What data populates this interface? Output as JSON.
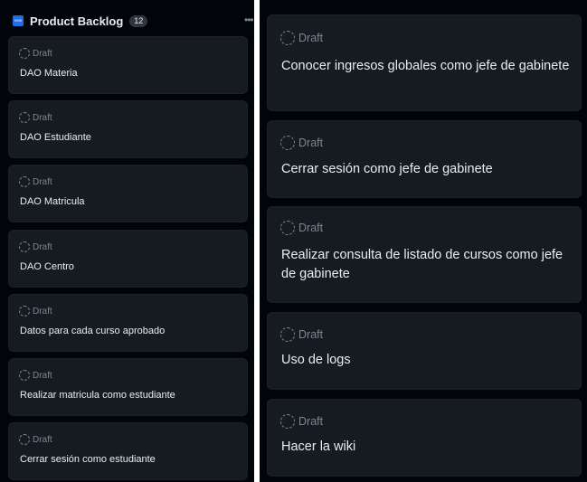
{
  "column": {
    "title": "Product Backlog",
    "count": "12",
    "icon_text": "new",
    "icon": "column-color-icon",
    "more_icon": "ellipsis-icon",
    "accent_color": "#1f6feb"
  },
  "status_icon": "draft-dashed-circle-icon",
  "left_cards": [
    {
      "status": "Draft",
      "title": "DAO Materia"
    },
    {
      "status": "Draft",
      "title": "DAO Estudiante"
    },
    {
      "status": "Draft",
      "title": "DAO Matricula"
    },
    {
      "status": "Draft",
      "title": "DAO Centro"
    },
    {
      "status": "Draft",
      "title": "Datos para cada curso aprobado"
    },
    {
      "status": "Draft",
      "title": "Realizar matricula como estudiante"
    },
    {
      "status": "Draft",
      "title": "Cerrar sesión como estudiante"
    }
  ],
  "right_cards": [
    {
      "status": "Draft",
      "title": "Conocer ingresos globales como jefe de gabinete"
    },
    {
      "status": "Draft",
      "title": "Cerrar sesión como jefe de gabinete"
    },
    {
      "status": "Draft",
      "title": "Realizar consulta de listado de cursos como jefe de gabinete"
    },
    {
      "status": "Draft",
      "title": "Uso de logs"
    },
    {
      "status": "Draft",
      "title": "Hacer la wiki"
    }
  ]
}
